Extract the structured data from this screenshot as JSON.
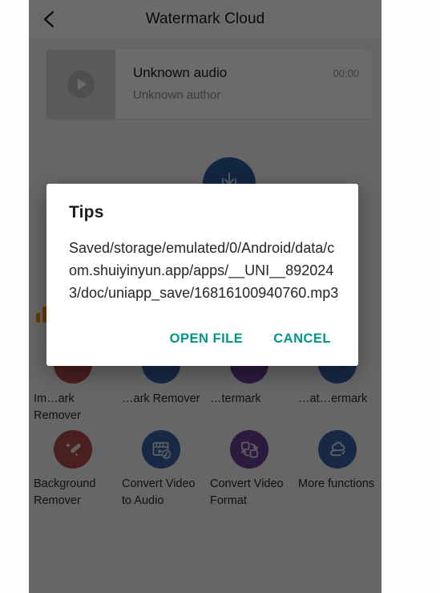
{
  "appbar": {
    "title": "Watermark Cloud",
    "back_icon": "chevron-left-icon"
  },
  "audio_card": {
    "thumb_icon": "play-circle-icon",
    "title": "Unknown audio",
    "author": "Unknown author",
    "duration": "00:00"
  },
  "fab": {
    "icon": "download-icon",
    "color": "#2f5c9e"
  },
  "wave_marker": {
    "icon": "audio-bars-icon",
    "color": "#ef8a12"
  },
  "functions": {
    "row1": [
      {
        "label": "Im…ark Remover",
        "icon": "image-watermark-remover-icon",
        "color": "#b04a4a"
      },
      {
        "label": "…ark Remover",
        "icon": "video-watermark-remover-icon",
        "color": "#3a63a8"
      },
      {
        "label": "…termark",
        "icon": "add-watermark-icon",
        "color": "#6d3f95"
      },
      {
        "label": "…at…ermark",
        "icon": "batch-watermark-icon",
        "color": "#3a63a8"
      }
    ],
    "row2": [
      {
        "label": "Background Remover",
        "icon": "magic-wand-icon",
        "color": "#b04a4a"
      },
      {
        "label": "Convert Video to Audio",
        "icon": "video-to-audio-icon",
        "color": "#3a63a8"
      },
      {
        "label": "Convert Video Format",
        "icon": "convert-format-icon",
        "color": "#6d3f95"
      },
      {
        "label": "More functions",
        "icon": "cloud-icon",
        "color": "#3a63a8"
      }
    ]
  },
  "dialog": {
    "title": "Tips",
    "message": "Saved/storage/emulated/0/Android/data/com.shuiyinyun.app/apps/__UNI__8920243/doc/uniapp_save/16816100940760.mp3",
    "open_label": "OPEN FILE",
    "cancel_label": "CANCEL",
    "accent_color": "#009688"
  }
}
